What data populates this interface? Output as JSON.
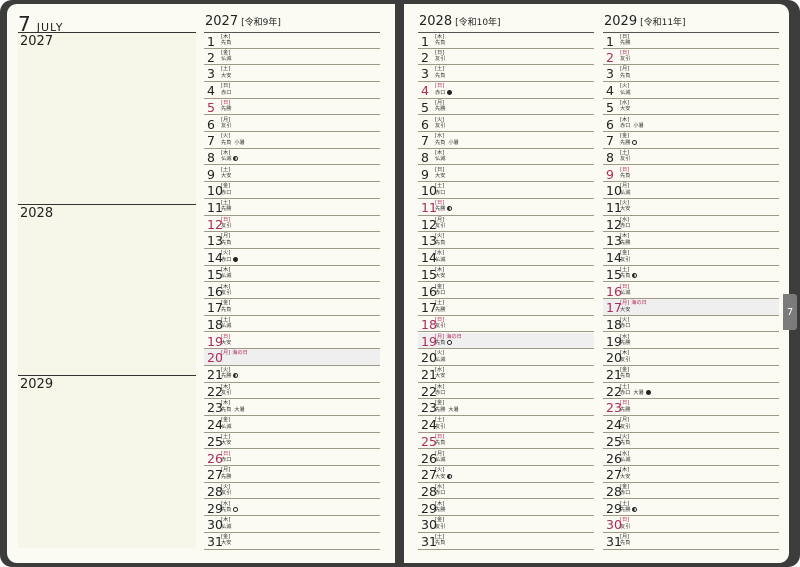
{
  "month": {
    "number": "7",
    "name": "JULY"
  },
  "memo_years": [
    "2027",
    "2028",
    "2029"
  ],
  "tab_label": "7",
  "columns": [
    {
      "year": "2027",
      "era": "[令和9年]",
      "days": [
        {
          "d": "1",
          "wd": "[木]",
          "rk": "先負"
        },
        {
          "d": "2",
          "wd": "[金]",
          "rk": "仏滅"
        },
        {
          "d": "3",
          "wd": "[土]",
          "rk": "大安"
        },
        {
          "d": "4",
          "wd": "[日]",
          "rk": "赤口"
        },
        {
          "d": "5",
          "wd": "[日]",
          "rk": "先勝",
          "red": true
        },
        {
          "d": "6",
          "wd": "[月]",
          "rk": "友引"
        },
        {
          "d": "7",
          "wd": "[火]",
          "rk": "先負",
          "ex": "小暑"
        },
        {
          "d": "8",
          "wd": "[木]",
          "rk": "仏滅",
          "moon": "half"
        },
        {
          "d": "9",
          "wd": "[土]",
          "rk": "大安"
        },
        {
          "d": "10",
          "wd": "[金]",
          "rk": "赤口"
        },
        {
          "d": "11",
          "wd": "[土]",
          "rk": "先勝"
        },
        {
          "d": "12",
          "wd": "[日]",
          "rk": "友引",
          "red": true
        },
        {
          "d": "13",
          "wd": "[月]",
          "rk": "先負"
        },
        {
          "d": "14",
          "wd": "[火]",
          "rk": "赤口",
          "moon": "new"
        },
        {
          "d": "15",
          "wd": "[木]",
          "rk": "仏滅"
        },
        {
          "d": "16",
          "wd": "[木]",
          "rk": "友引"
        },
        {
          "d": "17",
          "wd": "[金]",
          "rk": "先負"
        },
        {
          "d": "18",
          "wd": "[土]",
          "rk": "仏滅"
        },
        {
          "d": "19",
          "wd": "[日]",
          "rk": "大安",
          "red": true
        },
        {
          "d": "20",
          "wd": "[月]",
          "rk": "",
          "holiday": "海の日",
          "red": true,
          "hol": true
        },
        {
          "d": "21",
          "wd": "[火]",
          "rk": "先勝",
          "moon": "half"
        },
        {
          "d": "22",
          "wd": "[木]",
          "rk": "友引"
        },
        {
          "d": "23",
          "wd": "[木]",
          "rk": "先負",
          "ex": "大暑"
        },
        {
          "d": "24",
          "wd": "[金]",
          "rk": "仏滅"
        },
        {
          "d": "25",
          "wd": "[土]",
          "rk": "大安"
        },
        {
          "d": "26",
          "wd": "[日]",
          "rk": "赤口",
          "red": true
        },
        {
          "d": "27",
          "wd": "[月]",
          "rk": "先勝"
        },
        {
          "d": "28",
          "wd": "[火]",
          "rk": "友引"
        },
        {
          "d": "29",
          "wd": "[水]",
          "rk": "先負",
          "moon": "full"
        },
        {
          "d": "30",
          "wd": "[木]",
          "rk": "仏滅"
        },
        {
          "d": "31",
          "wd": "[金]",
          "rk": "大安"
        }
      ]
    },
    {
      "year": "2028",
      "era": "[令和10年]",
      "days": [
        {
          "d": "1",
          "wd": "[木]",
          "rk": "先負"
        },
        {
          "d": "2",
          "wd": "[日]",
          "rk": "友引"
        },
        {
          "d": "3",
          "wd": "[土]",
          "rk": "先負"
        },
        {
          "d": "4",
          "wd": "[日]",
          "rk": "赤口",
          "moon": "new",
          "red": true
        },
        {
          "d": "5",
          "wd": "[月]",
          "rk": "先勝"
        },
        {
          "d": "6",
          "wd": "[火]",
          "rk": "友引"
        },
        {
          "d": "7",
          "wd": "[水]",
          "rk": "先負",
          "ex": "小暑"
        },
        {
          "d": "8",
          "wd": "[木]",
          "rk": "仏滅"
        },
        {
          "d": "9",
          "wd": "[日]",
          "rk": "大安"
        },
        {
          "d": "10",
          "wd": "[土]",
          "rk": "赤口"
        },
        {
          "d": "11",
          "wd": "[日]",
          "rk": "先勝",
          "moon": "half",
          "red": true
        },
        {
          "d": "12",
          "wd": "[月]",
          "rk": "友引"
        },
        {
          "d": "13",
          "wd": "[火]",
          "rk": "先負"
        },
        {
          "d": "14",
          "wd": "[水]",
          "rk": "仏滅"
        },
        {
          "d": "15",
          "wd": "[木]",
          "rk": "大安"
        },
        {
          "d": "16",
          "wd": "[金]",
          "rk": "赤口"
        },
        {
          "d": "17",
          "wd": "[土]",
          "rk": "先勝"
        },
        {
          "d": "18",
          "wd": "[日]",
          "rk": "友引",
          "red": true
        },
        {
          "d": "19",
          "wd": "[月]",
          "rk": "先負",
          "holiday": "海の日",
          "moon": "full",
          "red": true,
          "hol": true
        },
        {
          "d": "20",
          "wd": "[火]",
          "rk": "仏滅"
        },
        {
          "d": "21",
          "wd": "[水]",
          "rk": "大安"
        },
        {
          "d": "22",
          "wd": "[木]",
          "rk": "赤口"
        },
        {
          "d": "23",
          "wd": "[金]",
          "rk": "先勝",
          "ex": "大暑"
        },
        {
          "d": "24",
          "wd": "[土]",
          "rk": "友引"
        },
        {
          "d": "25",
          "wd": "[日]",
          "rk": "先負",
          "red": true
        },
        {
          "d": "26",
          "wd": "[月]",
          "rk": "仏滅"
        },
        {
          "d": "27",
          "wd": "[火]",
          "rk": "大安",
          "moon": "half"
        },
        {
          "d": "28",
          "wd": "[水]",
          "rk": "赤口"
        },
        {
          "d": "29",
          "wd": "[木]",
          "rk": "先勝"
        },
        {
          "d": "30",
          "wd": "[金]",
          "rk": "友引"
        },
        {
          "d": "31",
          "wd": "[土]",
          "rk": "先負"
        }
      ]
    },
    {
      "year": "2029",
      "era": "[令和11年]",
      "days": [
        {
          "d": "1",
          "wd": "[日]",
          "rk": "先勝"
        },
        {
          "d": "2",
          "wd": "[日]",
          "rk": "友引",
          "red": true
        },
        {
          "d": "3",
          "wd": "[月]",
          "rk": "先負"
        },
        {
          "d": "4",
          "wd": "[火]",
          "rk": "仏滅"
        },
        {
          "d": "5",
          "wd": "[水]",
          "rk": "大安"
        },
        {
          "d": "6",
          "wd": "[木]",
          "rk": "赤口",
          "ex": "小暑"
        },
        {
          "d": "7",
          "wd": "[金]",
          "rk": "先勝",
          "moon": "full"
        },
        {
          "d": "8",
          "wd": "[土]",
          "rk": "友引"
        },
        {
          "d": "9",
          "wd": "[日]",
          "rk": "先負",
          "red": true
        },
        {
          "d": "10",
          "wd": "[月]",
          "rk": "仏滅"
        },
        {
          "d": "11",
          "wd": "[火]",
          "rk": "大安"
        },
        {
          "d": "12",
          "wd": "[水]",
          "rk": "赤口"
        },
        {
          "d": "13",
          "wd": "[木]",
          "rk": "先勝"
        },
        {
          "d": "14",
          "wd": "[金]",
          "rk": "友引"
        },
        {
          "d": "15",
          "wd": "[土]",
          "rk": "先負",
          "moon": "half"
        },
        {
          "d": "16",
          "wd": "[日]",
          "rk": "仏滅",
          "red": true
        },
        {
          "d": "17",
          "wd": "[月]",
          "rk": "大安",
          "holiday": "海の日",
          "red": true,
          "hol": true
        },
        {
          "d": "18",
          "wd": "[火]",
          "rk": "赤口"
        },
        {
          "d": "19",
          "wd": "[水]",
          "rk": "先勝"
        },
        {
          "d": "20",
          "wd": "[木]",
          "rk": "友引"
        },
        {
          "d": "21",
          "wd": "[金]",
          "rk": "先負"
        },
        {
          "d": "22",
          "wd": "[土]",
          "rk": "赤口",
          "ex": "大暑",
          "moon": "new"
        },
        {
          "d": "23",
          "wd": "[日]",
          "rk": "先勝",
          "red": true
        },
        {
          "d": "24",
          "wd": "[月]",
          "rk": "友引"
        },
        {
          "d": "25",
          "wd": "[火]",
          "rk": "先負"
        },
        {
          "d": "26",
          "wd": "[水]",
          "rk": "仏滅"
        },
        {
          "d": "27",
          "wd": "[木]",
          "rk": "大安"
        },
        {
          "d": "28",
          "wd": "[金]",
          "rk": "赤口"
        },
        {
          "d": "29",
          "wd": "[土]",
          "rk": "先勝",
          "moon": "half"
        },
        {
          "d": "30",
          "wd": "[日]",
          "rk": "友引",
          "red": true
        },
        {
          "d": "31",
          "wd": "[月]",
          "rk": "先負"
        }
      ]
    }
  ]
}
